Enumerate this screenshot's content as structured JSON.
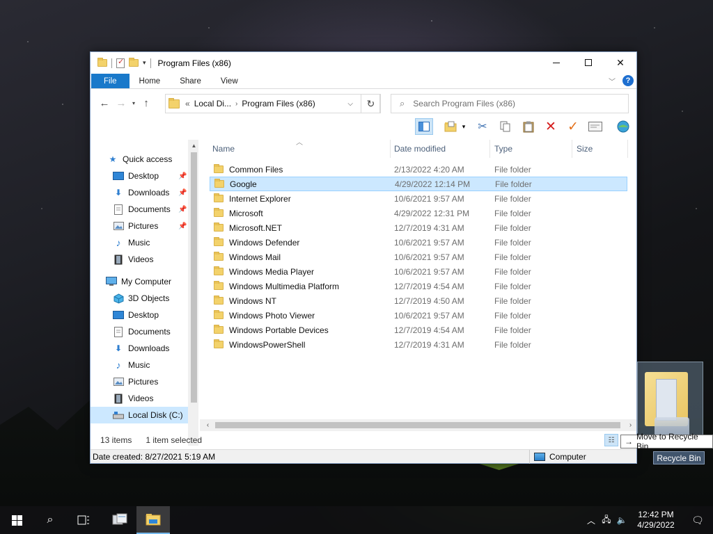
{
  "window": {
    "title": "Program Files (x86)"
  },
  "ribbon": {
    "tabs": [
      "File",
      "Home",
      "Share",
      "View"
    ]
  },
  "address": {
    "prefix": "«",
    "crumb1": "Local Di...",
    "crumb2": "Program Files (x86)"
  },
  "search": {
    "placeholder": "Search Program Files (x86)"
  },
  "nav": {
    "quick_access": "Quick access",
    "quick_items": [
      "Desktop",
      "Downloads",
      "Documents",
      "Pictures",
      "Music",
      "Videos"
    ],
    "my_computer": "My Computer",
    "computer_items": [
      "3D Objects",
      "Desktop",
      "Documents",
      "Downloads",
      "Music",
      "Pictures",
      "Videos",
      "Local Disk (C:)"
    ]
  },
  "columns": {
    "name": "Name",
    "date": "Date modified",
    "type": "Type",
    "size": "Size"
  },
  "files": [
    {
      "name": "Common Files",
      "date": "2/13/2022 4:20 AM",
      "type": "File folder"
    },
    {
      "name": "Google",
      "date": "4/29/2022 12:14 PM",
      "type": "File folder"
    },
    {
      "name": "Internet Explorer",
      "date": "10/6/2021 9:57 AM",
      "type": "File folder"
    },
    {
      "name": "Microsoft",
      "date": "4/29/2022 12:31 PM",
      "type": "File folder"
    },
    {
      "name": "Microsoft.NET",
      "date": "12/7/2019 4:31 AM",
      "type": "File folder"
    },
    {
      "name": "Windows Defender",
      "date": "10/6/2021 9:57 AM",
      "type": "File folder"
    },
    {
      "name": "Windows Mail",
      "date": "10/6/2021 9:57 AM",
      "type": "File folder"
    },
    {
      "name": "Windows Media Player",
      "date": "10/6/2021 9:57 AM",
      "type": "File folder"
    },
    {
      "name": "Windows Multimedia Platform",
      "date": "12/7/2019 4:54 AM",
      "type": "File folder"
    },
    {
      "name": "Windows NT",
      "date": "12/7/2019 4:50 AM",
      "type": "File folder"
    },
    {
      "name": "Windows Photo Viewer",
      "date": "10/6/2021 9:57 AM",
      "type": "File folder"
    },
    {
      "name": "Windows Portable Devices",
      "date": "12/7/2019 4:54 AM",
      "type": "File folder"
    },
    {
      "name": "WindowsPowerShell",
      "date": "12/7/2019 4:31 AM",
      "type": "File folder"
    }
  ],
  "selected_index": 1,
  "status": {
    "count": "13 items",
    "selected": "1 item selected",
    "date_created": "Date created: 8/27/2021 5:19 AM",
    "location": "Computer"
  },
  "desktop": {
    "tooltip": "Move to Recycle Bin",
    "recycle_label": "Recycle Bin"
  },
  "clock": {
    "time": "12:42 PM",
    "date": "4/29/2022"
  },
  "colors": {
    "accent": "#1979ca",
    "selection": "#cce8ff",
    "folder": "#f3d26b"
  }
}
